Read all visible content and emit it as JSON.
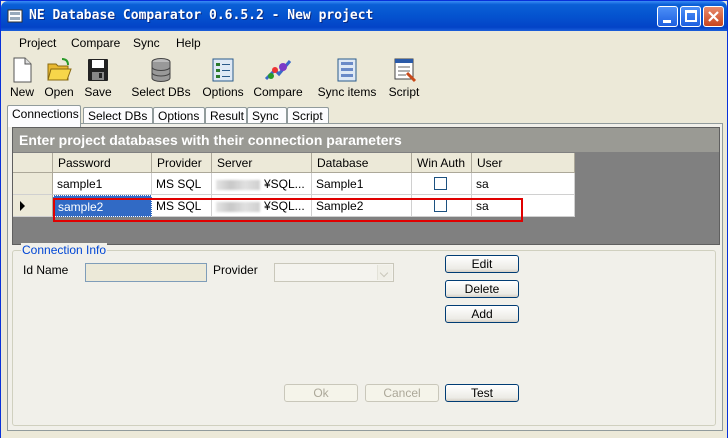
{
  "window": {
    "title": "NE Database Comparator 0.6.5.2 - New project"
  },
  "menu": [
    {
      "label": "Project"
    },
    {
      "label": "Compare"
    },
    {
      "label": "Sync"
    },
    {
      "label": "Help"
    }
  ],
  "toolbar": [
    {
      "label": "New",
      "icon": "new-file-icon"
    },
    {
      "label": "Open",
      "icon": "open-folder-icon"
    },
    {
      "label": "Save",
      "icon": "save-disk-icon"
    },
    {
      "label": "Select DBs",
      "icon": "database-icon"
    },
    {
      "label": "Options",
      "icon": "options-icon"
    },
    {
      "label": "Compare",
      "icon": "compare-icon"
    },
    {
      "label": "Sync items",
      "icon": "sync-items-icon"
    },
    {
      "label": "Script",
      "icon": "script-icon"
    }
  ],
  "tabs": [
    {
      "label": "Connections",
      "active": true
    },
    {
      "label": "Select DBs"
    },
    {
      "label": "Options"
    },
    {
      "label": "Result"
    },
    {
      "label": "Sync"
    },
    {
      "label": "Script"
    }
  ],
  "grid": {
    "header": "Enter project databases with their connection parameters",
    "columns": [
      "Password",
      "Provider",
      "Server",
      "Database",
      "Win Auth",
      "User"
    ],
    "rows": [
      {
        "password": "sample1",
        "provider": "MS SQL",
        "server": "¥SQL...",
        "database": "Sample1",
        "win_auth": false,
        "user": "sa"
      },
      {
        "password": "sample2",
        "provider": "MS SQL",
        "server": "¥SQL...",
        "database": "Sample2",
        "win_auth": false,
        "user": "sa",
        "current": true
      }
    ]
  },
  "connection_info": {
    "legend": "Connection Info",
    "id_name_label": "Id Name",
    "id_name_value": "",
    "provider_label": "Provider",
    "provider_value": "",
    "buttons": {
      "edit": "Edit",
      "delete": "Delete",
      "add": "Add",
      "ok": "Ok",
      "cancel": "Cancel",
      "test": "Test"
    }
  },
  "colors": {
    "titlebar": "#0453cf",
    "selection": "#316ac5",
    "highlight_box": "#e00000",
    "group_legend": "#0046d5"
  }
}
